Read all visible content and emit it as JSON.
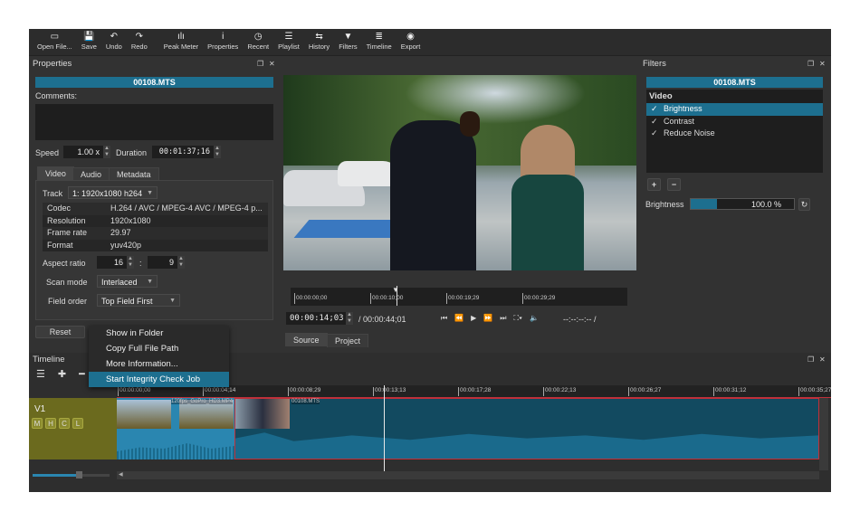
{
  "toolbar": [
    {
      "label": "Open File...",
      "icon": "folder-icon",
      "glyph": "▭"
    },
    {
      "label": "Save",
      "icon": "save-icon",
      "glyph": "💾"
    },
    {
      "label": "Undo",
      "icon": "undo-icon",
      "glyph": "↶"
    },
    {
      "label": "Redo",
      "icon": "redo-icon",
      "glyph": "↷"
    },
    {
      "label": "Peak Meter",
      "icon": "peak-meter-icon",
      "glyph": "ılı"
    },
    {
      "label": "Properties",
      "icon": "info-icon",
      "glyph": "i"
    },
    {
      "label": "Recent",
      "icon": "clock-icon",
      "glyph": "◷"
    },
    {
      "label": "Playlist",
      "icon": "list-icon",
      "glyph": "☰"
    },
    {
      "label": "History",
      "icon": "history-icon",
      "glyph": "⇆"
    },
    {
      "label": "Filters",
      "icon": "filter-icon",
      "glyph": "▼"
    },
    {
      "label": "Timeline",
      "icon": "timeline-icon",
      "glyph": "≣"
    },
    {
      "label": "Export",
      "icon": "export-icon",
      "glyph": "◉"
    }
  ],
  "properties": {
    "title": "Properties",
    "clip_name": "00108.MTS",
    "comments_label": "Comments:",
    "comments_value": "",
    "speed_label": "Speed",
    "speed_value": "1.00 x",
    "duration_label": "Duration",
    "duration_value": "00:01:37;16",
    "tabs": [
      "Video",
      "Audio",
      "Metadata"
    ],
    "track_label": "Track",
    "track_value": "1: 1920x1080 h264",
    "info_rows": [
      [
        "Codec",
        "H.264 / AVC / MPEG-4 AVC / MPEG-4 p..."
      ],
      [
        "Resolution",
        "1920x1080"
      ],
      [
        "Frame rate",
        "29.97"
      ],
      [
        "Format",
        "yuv420p"
      ]
    ],
    "aspect_label": "Aspect ratio",
    "aspect_w": "16",
    "aspect_sep": ":",
    "aspect_h": "9",
    "scan_label": "Scan mode",
    "scan_value": "Interlaced",
    "field_label": "Field order",
    "field_value": "Top Field First",
    "reset_label": "Reset"
  },
  "context_menu": [
    "Show in Folder",
    "Copy Full File Path",
    "More Information...",
    "Start Integrity Check Job"
  ],
  "player": {
    "ruler": [
      "00:00:00;00",
      "00:00:10;00",
      "00:00:19;29",
      "00:00:29;29"
    ],
    "position": "00:00:14;03",
    "duration": "/ 00:00:44;01",
    "in_out": "--:--:--:-- /",
    "tabs": [
      "Source",
      "Project"
    ]
  },
  "filters": {
    "title": "Filters",
    "clip_name": "00108.MTS",
    "group": "Video",
    "items": [
      {
        "name": "Brightness",
        "checked": true,
        "selected": true
      },
      {
        "name": "Contrast",
        "checked": true
      },
      {
        "name": "Reduce Noise",
        "checked": true
      }
    ],
    "param_label": "Brightness",
    "param_value": "100.0 %",
    "param_fraction": 0.25
  },
  "timeline": {
    "title": "Timeline",
    "track": "V1",
    "track_buttons": [
      "M",
      "H",
      "C",
      "L"
    ],
    "ruler": [
      "00:00:00;00",
      "00:00:04;14",
      "00:00:08;29",
      "00:00:13;13",
      "00:00:17;28",
      "00:00:22;13",
      "00:00:26;27",
      "00:00:31;12",
      "00:00:35;27"
    ],
    "clips": [
      "120fps_GoPro_HD3.MP4",
      "00108.MTS"
    ]
  },
  "colors": {
    "accent": "#1d6f8f",
    "track_head": "#6b6a1e",
    "clip": "#1a5f7a",
    "playhead": "#e8e8e8",
    "selection": "#c0303a"
  }
}
